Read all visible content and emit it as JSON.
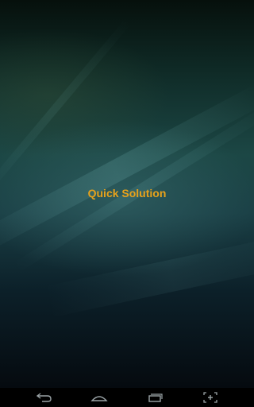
{
  "app": {
    "title": "Quick Solution",
    "title_color": "#e8a21b"
  },
  "navbar": {
    "buttons": [
      {
        "icon": "back-icon"
      },
      {
        "icon": "home-icon"
      },
      {
        "icon": "recent-apps-icon"
      },
      {
        "icon": "screenshot-icon"
      }
    ]
  }
}
